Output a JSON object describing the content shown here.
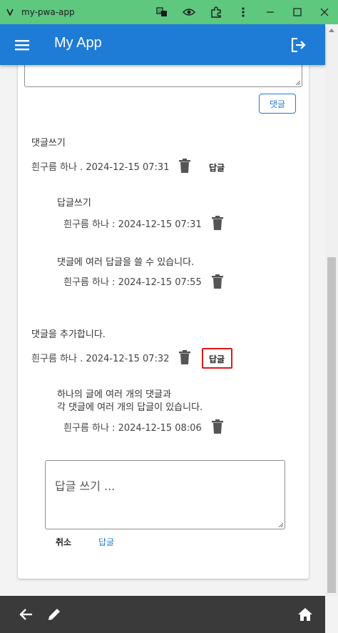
{
  "window": {
    "title": "my-pwa-app"
  },
  "appbar": {
    "title": "My App",
    "menu_icon": "menu-icon",
    "logout_icon": "logout-icon",
    "color": "#1e7bd6"
  },
  "comment_form": {
    "submit_label": "댓글"
  },
  "comments": [
    {
      "text": "댓글쓰기",
      "meta": "흰구름 하나 . 2024-12-15 07:31",
      "reply_label": "답글",
      "replies": [
        {
          "text": "답글쓰기",
          "meta": "흰구름 하나 : 2024-12-15 07:31"
        },
        {
          "text": "댓글에 여러 답글을 쓸 수 있습니다.",
          "meta": "흰구름 하나 : 2024-12-15 07:55"
        }
      ]
    },
    {
      "text": "댓글을 추가합니다.",
      "meta": "흰구름 하나 . 2024-12-15 07:32",
      "reply_label": "답글",
      "replies": [
        {
          "text_line1": "하나의 글에 여러 개의 댓글과",
          "text_line2": "각 댓글에 여러 개의 답글이 있습니다.",
          "meta": "흰구름 하나 : 2024-12-15 08:06"
        }
      ]
    }
  ],
  "reply_form": {
    "placeholder": "답글 쓰기 ...",
    "cancel_label": "취소",
    "submit_label": "답글"
  },
  "bottombar": {
    "icons": [
      "back-arrow-icon",
      "edit-icon",
      "home-icon"
    ]
  },
  "colors": {
    "titlebar": "#5fc87f",
    "accent": "#1e7bd6",
    "highlight": "#e01818",
    "bottombar": "#3a3a3a"
  }
}
